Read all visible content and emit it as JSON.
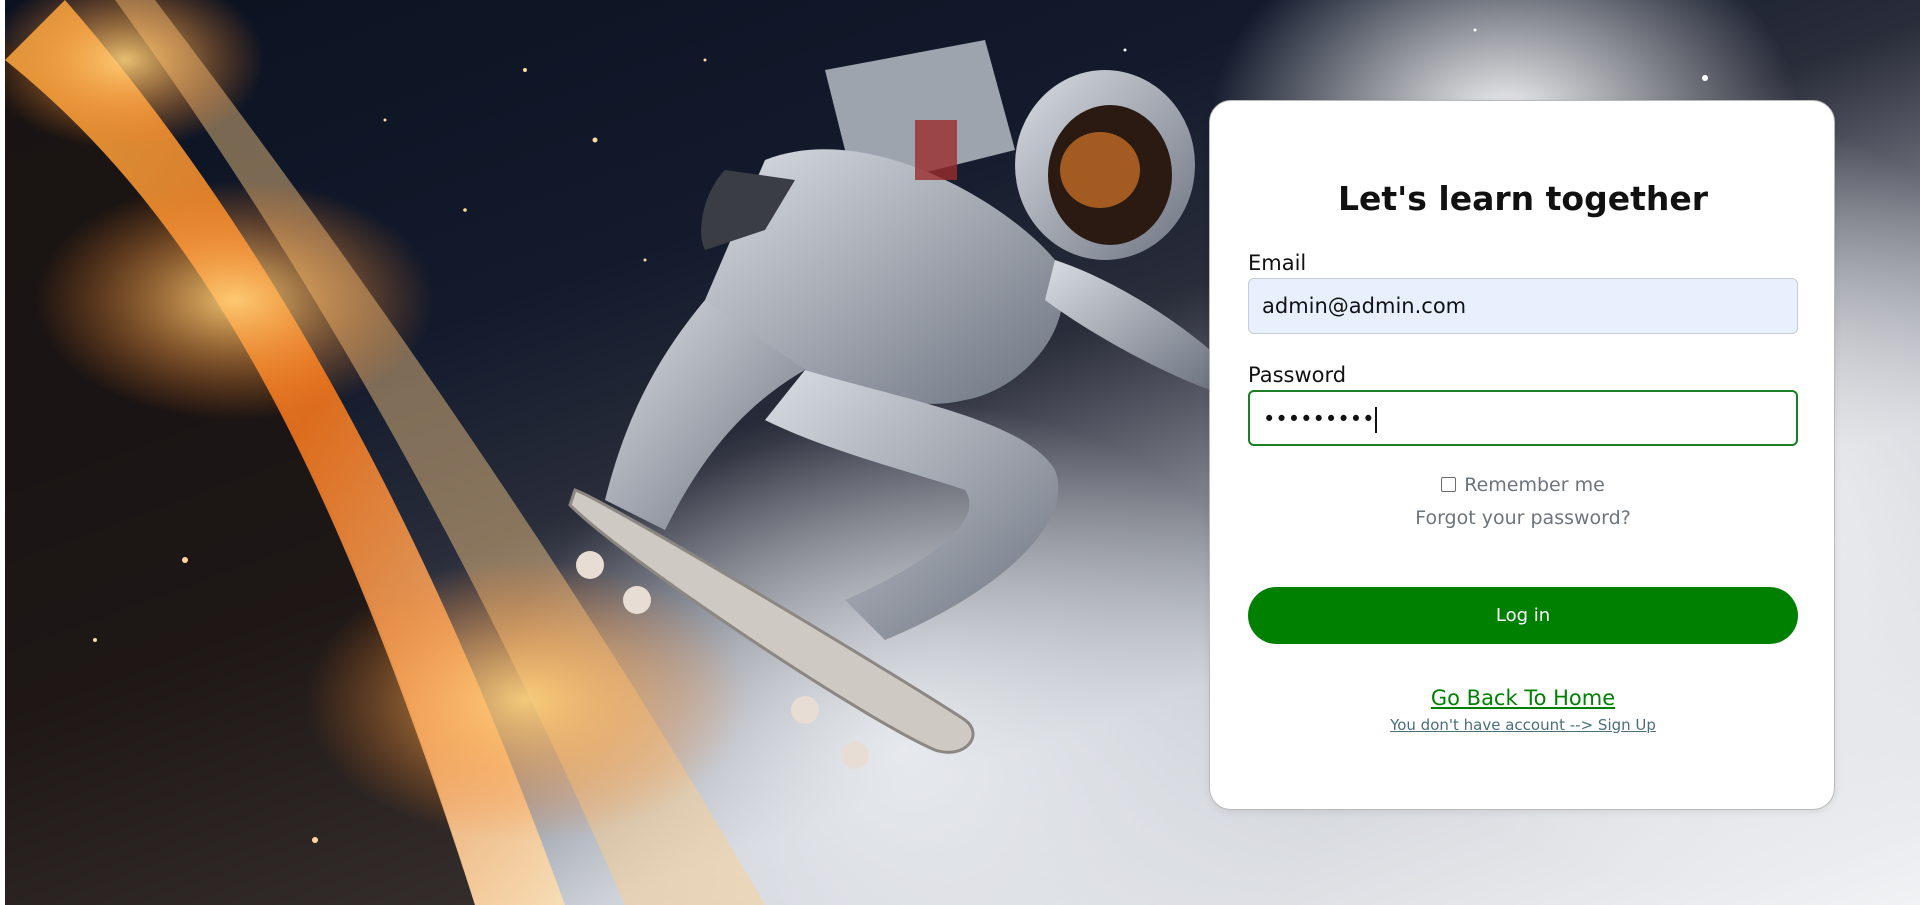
{
  "login": {
    "title": "Let's learn together",
    "email_label": "Email",
    "email_value": "admin@admin.com",
    "password_label": "Password",
    "password_value": "•••••••••",
    "remember_label": "Remember me",
    "remember_checked": false,
    "forgot_link": "Forgot your password?",
    "login_button": "Log in",
    "home_link": "Go Back To Home",
    "signup_link": "You don't have account --> Sign Up"
  },
  "colors": {
    "accent_green": "#008000",
    "email_bg": "#e8f0fe",
    "muted_text": "#6c757d"
  }
}
